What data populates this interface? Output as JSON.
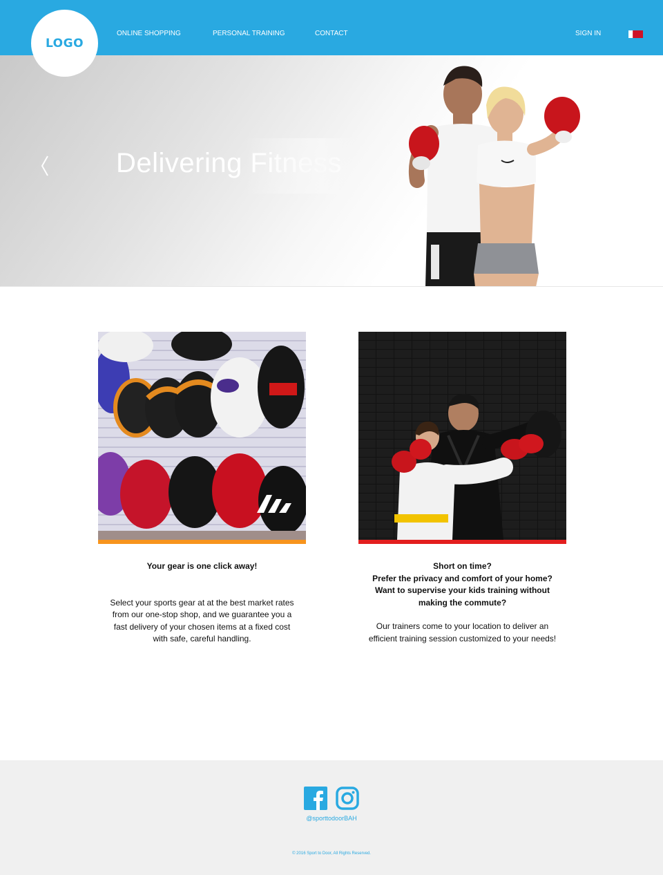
{
  "header": {
    "logo": "LOGO",
    "nav": [
      {
        "label": "ONLINE SHOPPING"
      },
      {
        "label": "PERSONAL TRAINING"
      },
      {
        "label": "CONTACT"
      }
    ],
    "signin": "SIGN IN",
    "language_flag_icon": "bahrain-flag-icon"
  },
  "hero": {
    "title": "Delivering Fitness",
    "prev_icon": "chevron-left-icon",
    "image_subject": "fitness-couple-boxing"
  },
  "cards": [
    {
      "image_subject": "boxing-headgear-display",
      "accent_color": "#f7941d",
      "heading_lines": [
        "Your gear is one click away!"
      ],
      "body_lines": [
        "Select your sports gear at at the best market rates",
        "from our one-stop shop, and we guarantee you a",
        "fast delivery of your chosen items at a fixed cost",
        "with safe, careful handling."
      ]
    },
    {
      "image_subject": "martial-arts-trainer-with-child",
      "accent_color": "#e31e1e",
      "heading_lines": [
        "Short on time?",
        "Prefer the privacy and comfort of your home?",
        "Want to supervise your kids training without",
        "making the commute?"
      ],
      "body_lines": [
        "Our trainers come to your location to deliver an",
        "efficient training session customized to your needs!"
      ]
    }
  ],
  "footer": {
    "social": [
      {
        "icon": "facebook-icon"
      },
      {
        "icon": "instagram-icon"
      }
    ],
    "handle": "@sporttodoorBAH",
    "copyright": "© 2016 Sport to Door, All Rights Reserved.",
    "brand_color": "#29a9e1"
  }
}
